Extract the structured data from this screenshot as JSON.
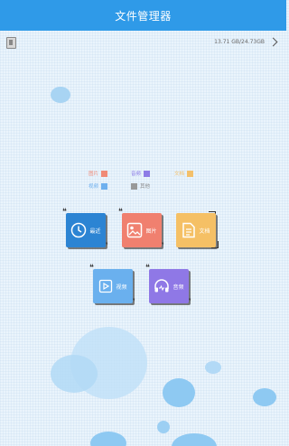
{
  "header": {
    "title": "文件管理器"
  },
  "storage": {
    "text": "13.71 GB/24.73GB"
  },
  "legend": [
    {
      "label": "图片",
      "color": "#f08a76"
    },
    {
      "label": "音频",
      "color": "#8d7ce6"
    },
    {
      "label": "文档",
      "color": "#f3c06b"
    },
    {
      "label": "视频",
      "color": "#6fb0ee"
    },
    {
      "label": "其他",
      "color": "#999999"
    }
  ],
  "categories": [
    {
      "label": "最近",
      "color": "#2c84d3",
      "icon": "clock-icon"
    },
    {
      "label": "图片",
      "color": "#f0806f",
      "icon": "image-icon"
    },
    {
      "label": "文档",
      "color": "#f5c065",
      "icon": "document-icon"
    },
    {
      "label": "视频",
      "color": "#6ab0ee",
      "icon": "play-icon"
    },
    {
      "label": "音频",
      "color": "#8f78e6",
      "icon": "headphones-icon"
    }
  ]
}
